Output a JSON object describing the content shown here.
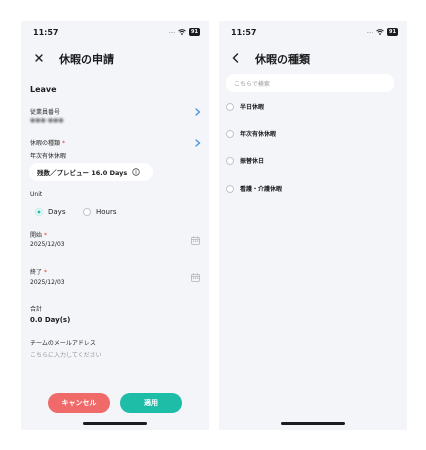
{
  "colors": {
    "cancel": "#f06a6a",
    "apply": "#1ebda8",
    "accent": "#1ebda8",
    "chevron": "#4a90e2"
  },
  "status": {
    "time": "11:57",
    "signal": "....",
    "battery": "91"
  },
  "form": {
    "title": "休暇の申請",
    "section": "Leave",
    "employee_no": {
      "label": "従業員番号",
      "value": "●●●-●●●"
    },
    "leave_type": {
      "label": "休暇の種類",
      "value": "年次有休休暇"
    },
    "balance": "残数／プレビュー 16.0 Days",
    "unit": {
      "label": "Unit",
      "options": [
        "Days",
        "Hours"
      ],
      "selected": "Days"
    },
    "start": {
      "label": "開始",
      "value": "2025/12/03"
    },
    "end": {
      "label": "終了",
      "value": "2025/12/03"
    },
    "total": {
      "label": "合計",
      "value": "0.0 Day(s)"
    },
    "team_email": {
      "label": "チームのメールアドレス",
      "placeholder": "こちらに入力してください"
    },
    "cancel_label": "キャンセル",
    "apply_label": "適用"
  },
  "picker": {
    "title": "休暇の種類",
    "search_placeholder": "こちらで検索",
    "options": [
      "半日休暇",
      "年次有休休暇",
      "振替休日",
      "看護・介護休暇"
    ]
  }
}
